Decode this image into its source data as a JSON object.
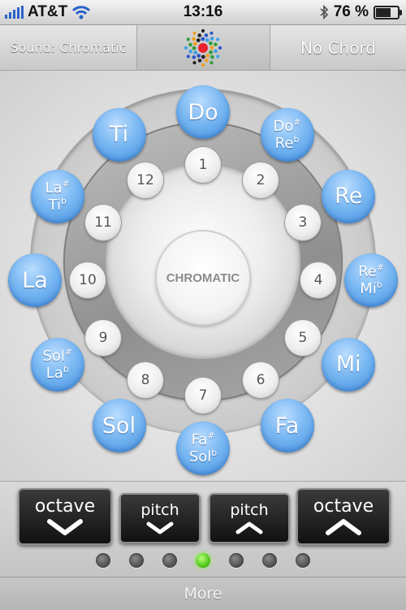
{
  "status_bar": {
    "carrier": "AT&T",
    "time": "13:16",
    "battery_text": "76 %",
    "battery_level": 0.76
  },
  "top_bar": {
    "sound_label": "Sound: Chromatic",
    "chord_label": "No Chord"
  },
  "wheel": {
    "center_label": "CHROMATIC",
    "numbers": [
      "1",
      "2",
      "3",
      "4",
      "5",
      "6",
      "7",
      "8",
      "9",
      "10",
      "11",
      "12"
    ],
    "notes": [
      {
        "lines": [
          "Do"
        ]
      },
      {
        "lines": [
          "Do#",
          "Reb"
        ]
      },
      {
        "lines": [
          "Re"
        ]
      },
      {
        "lines": [
          "Re#",
          "Mib"
        ]
      },
      {
        "lines": [
          "Mi"
        ]
      },
      {
        "lines": [
          "Fa"
        ]
      },
      {
        "lines": [
          "Fa#",
          "Solb"
        ]
      },
      {
        "lines": [
          "Sol"
        ]
      },
      {
        "lines": [
          "Sol#",
          "Lab"
        ]
      },
      {
        "lines": [
          "La"
        ]
      },
      {
        "lines": [
          "La#",
          "Tib"
        ]
      },
      {
        "lines": [
          "Ti"
        ]
      }
    ]
  },
  "controls": {
    "octave_down_label": "octave",
    "pitch_down_label": "pitch",
    "pitch_up_label": "pitch",
    "octave_up_label": "octave",
    "page_count": 7,
    "active_page": 4
  },
  "footer": {
    "more_label": "More"
  },
  "colors": {
    "note_blue": "#5aa4ec",
    "active_dot": "#52c81c",
    "logo_center": "#e8232d"
  }
}
